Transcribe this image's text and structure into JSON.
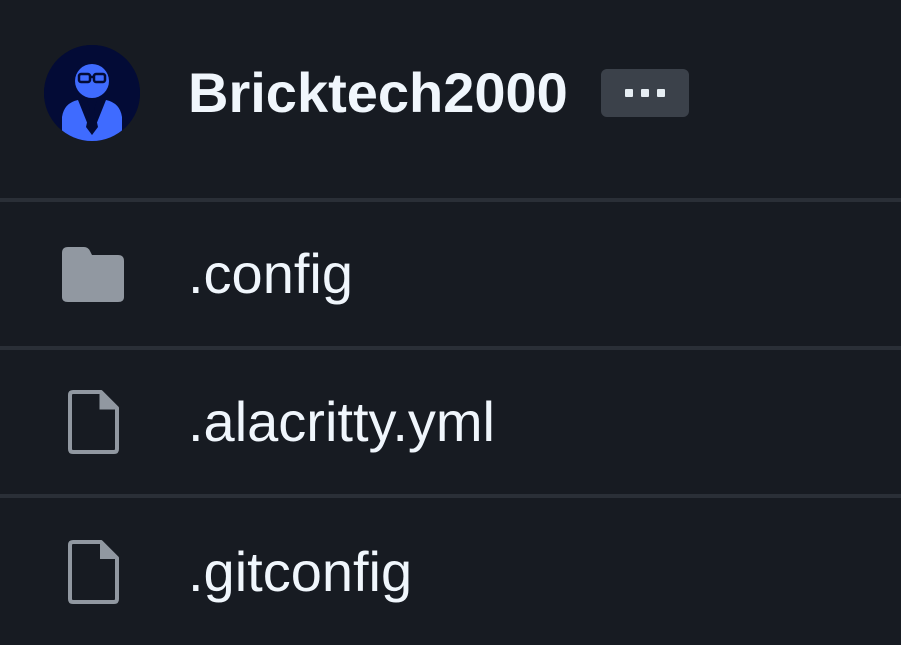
{
  "header": {
    "username": "Bricktech2000",
    "more_button_label": "More",
    "avatar_colors": {
      "background": "#030b36",
      "figure": "#3f6bff"
    }
  },
  "files": [
    {
      "name": ".config",
      "type": "folder",
      "icon": "folder-icon"
    },
    {
      "name": ".alacritty.yml",
      "type": "file",
      "icon": "file-icon"
    },
    {
      "name": ".gitconfig",
      "type": "file",
      "icon": "file-icon"
    }
  ],
  "colors": {
    "background": "#171b22",
    "divider": "#2a2f37",
    "text": "#f0f6fc",
    "icon": "#9198a1",
    "button_bg": "#3b414a"
  }
}
